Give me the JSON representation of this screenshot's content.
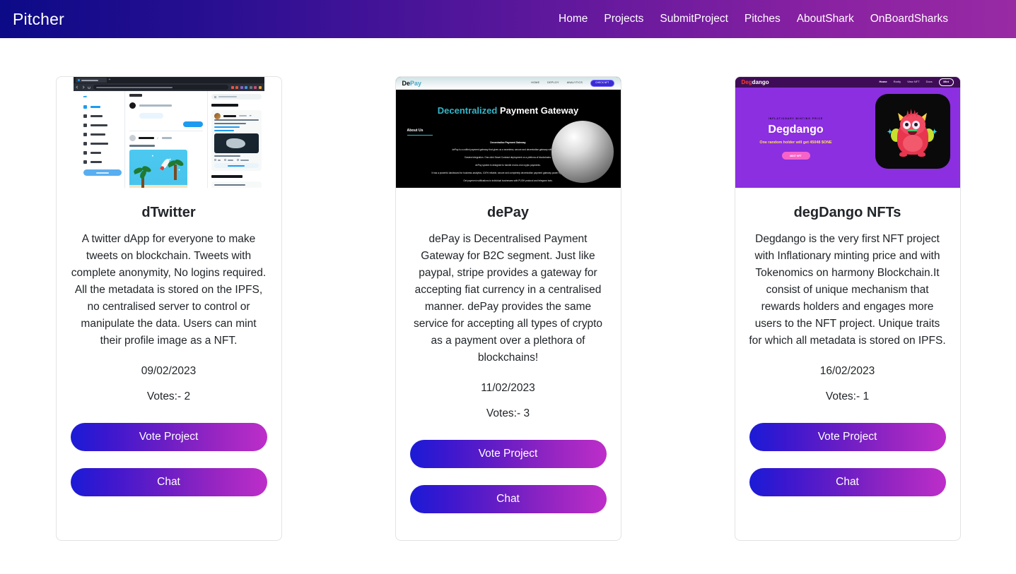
{
  "navbar": {
    "brand": "Pitcher",
    "links": [
      {
        "label": "Home"
      },
      {
        "label": "Projects"
      },
      {
        "label": "SubmitProject"
      },
      {
        "label": "Pitches"
      },
      {
        "label": "AboutShark"
      },
      {
        "label": "OnBoardSharks"
      }
    ],
    "gradient_from": "#0c0a87",
    "gradient_to": "#982aa4"
  },
  "buttons": {
    "vote_label": "Vote Project",
    "chat_label": "Chat",
    "gradient_from": "#1b1bd6",
    "gradient_to": "#bd2ec9"
  },
  "cards": [
    {
      "title": "dTwitter",
      "description": "A twitter dApp for everyone to make tweets on blockchain. Tweets with complete anonymity, No logins required. All the metadata is stored on the IPFS, no centralised server to control or manipulate the data. Users can mint their profile image as a NFT.",
      "date": "09/02/2023",
      "votes": "Votes:- 2",
      "preview_kind": "dtwitter-browser-screenshot"
    },
    {
      "title": "dePay",
      "description": "dePay is Decentralised Payment Gateway for B2C segment. Just like paypal, stripe provides a gateway for accepting fiat currency in a centralised manner. dePay provides the same service for accepting all types of crypto as a payment over a plethora of blockchains!",
      "date": "11/02/2023",
      "votes": "Votes:- 3",
      "preview_kind": "depay-landing-screenshot"
    },
    {
      "title": "degDango NFTs",
      "description": "Degdango is the very first NFT project with Inflationary minting price and with Tokenomics on harmony Blockchain.It consist of unique mechanism that rewards holders and engages more users to the NFT project. Unique traits for which all metadata is stored on IPFS.",
      "date": "16/02/2023",
      "votes": "Votes:- 1",
      "preview_kind": "degdango-landing-screenshot"
    }
  ],
  "preview_depay": {
    "logo_a": "De",
    "logo_b": "Pay",
    "menu": [
      "HOME",
      "DEPLOY",
      "ANALYTICS"
    ],
    "cta": "CHECK NFT",
    "heading_accent": "Decentralized",
    "heading_rest": " Payment Gateway",
    "tab": "About Us",
    "subheading": "Decentralise Payment Gateway",
    "paragraphs": [
      "dePay is a unified payment gateway that gives us a seamless, secure and decentralise gateway with end-to-end",
      "Easiest integration. One-click Smart Contract deployment on a plethora of blockchains.",
      "dePay system is designed to handle end-to-end crypto payments.",
      "It has a powerful dashboard for business analytics, 100% reliable, secure and completely decentralise payment gateway power by blockchain technology.",
      "Get payment notifications to individual businesses with PUSH protocol and telegram bots."
    ]
  },
  "preview_degdango": {
    "logo_a": "Deg",
    "logo_b": "dango",
    "menu": [
      "Home",
      "Rarity",
      "View NFT",
      "Docs"
    ],
    "mint_nav": "Mint",
    "kicker": "INFLATIONARY MINTING PRICE",
    "title": "Degdango",
    "subline": "One random holder will get 45048 $ONE",
    "mint_button": "MINT NFT"
  }
}
